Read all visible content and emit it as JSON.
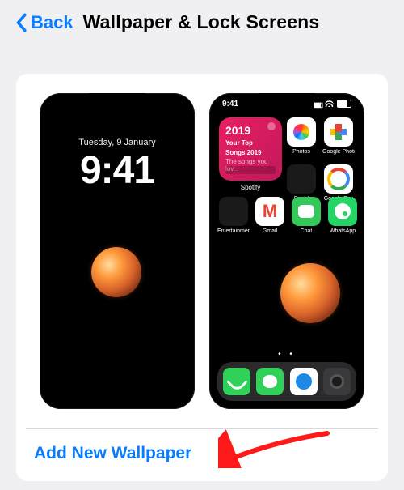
{
  "header": {
    "back_label": "Back",
    "title": "Wallpaper & Lock Screens"
  },
  "lock_preview": {
    "date": "Tuesday, 9 January",
    "time": "9:41"
  },
  "home_preview": {
    "status_time": "9:41",
    "widget": {
      "label": "Spotify",
      "year": "2019",
      "line1": "Your Top",
      "line2": "Songs 2019",
      "line3": "The songs you lov..."
    },
    "row1": [
      {
        "id": "photos",
        "label": "Photos"
      },
      {
        "id": "gphotos",
        "label": "Google Photos"
      },
      {
        "id": "social",
        "label": "Social"
      },
      {
        "id": "gpay",
        "label": "Google Pay"
      }
    ],
    "row2": [
      {
        "id": "entertainment",
        "label": "Entertainment"
      },
      {
        "id": "gmail",
        "label": "Gmail"
      },
      {
        "id": "chat",
        "label": "Chat"
      },
      {
        "id": "whatsapp",
        "label": "WhatsApp"
      }
    ],
    "pager": "• •",
    "dock": [
      "phone",
      "messages",
      "safari",
      "camera"
    ]
  },
  "actions": {
    "add_wallpaper": "Add New Wallpaper"
  }
}
